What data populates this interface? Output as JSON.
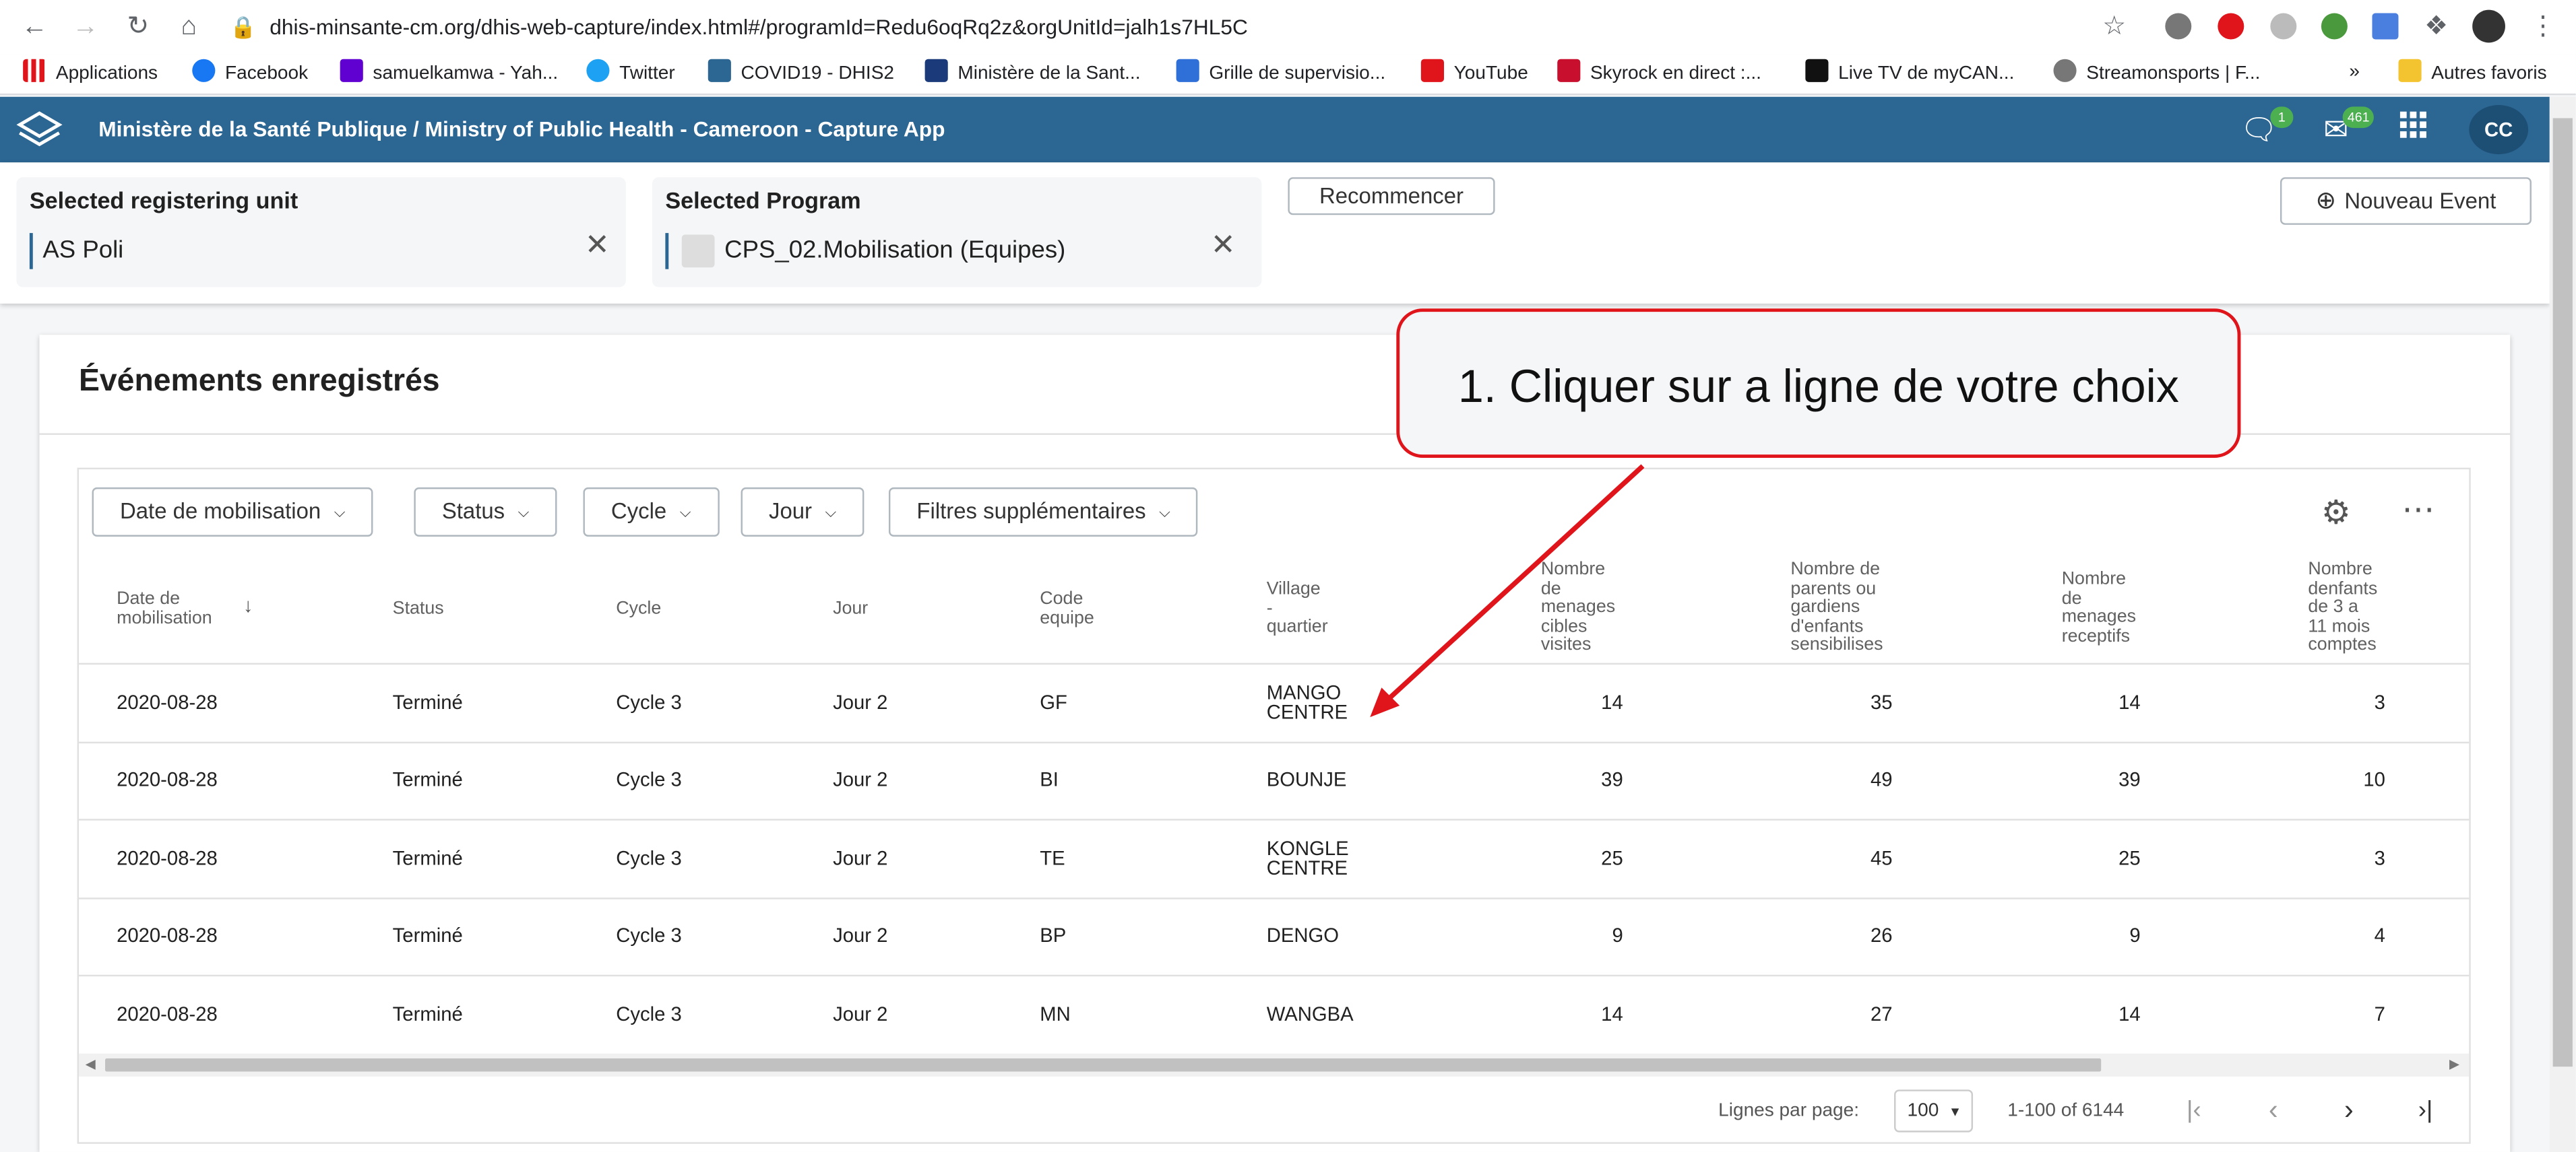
{
  "browser": {
    "url": "dhis-minsante-cm.org/dhis-web-capture/index.html#/programId=Redu6oqRq2z&orgUnitId=jalh1s7HL5C",
    "bookmarks": [
      "Applications",
      "Facebook",
      "samuelkamwa - Yah...",
      "Twitter",
      "COVID19 - DHIS2",
      "Ministère de la Sant...",
      "Grille de supervisio...",
      "YouTube",
      "Skyrock en direct :...",
      "Live TV de myCAN...",
      "Streamonsports | F..."
    ],
    "bookmarks_more": "»",
    "other_bookmarks": "Autres favoris"
  },
  "header": {
    "title": "Ministère de la Santé Publique / Ministry of Public Health - Cameroon - Capture App",
    "messages_badge": "1",
    "mail_badge": "461",
    "avatar": "CC"
  },
  "selectors": {
    "unit_label": "Selected registering unit",
    "unit_value": "AS Poli",
    "program_label": "Selected Program",
    "program_value": "CPS_02.Mobilisation (Equipes)",
    "reset_label": "Recommencer",
    "new_event_label": "Nouveau Event"
  },
  "main": {
    "title": "Événements enregistrés",
    "filters": [
      "Date de mobilisation",
      "Status",
      "Cycle",
      "Jour",
      "Filtres supplémentaires"
    ],
    "columns": [
      "Date de\nmobilisation",
      "Status",
      "Cycle",
      "Jour",
      "Code\nequipe",
      "Village\n-\nquartier",
      "Nombre\nde\nmenages\ncibles\nvisites",
      "Nombre de\nparents ou\ngardiens\nd'enfants\nsensibilises",
      "Nombre\nde\nmenages\nreceptifs",
      "Nombre\ndenfants\nde 3 a\n11 mois\ncomptes"
    ],
    "rows": [
      [
        "2020-08-28",
        "Terminé",
        "Cycle 3",
        "Jour 2",
        "GF",
        "MANGO\nCENTRE",
        "14",
        "35",
        "14",
        "3"
      ],
      [
        "2020-08-28",
        "Terminé",
        "Cycle 3",
        "Jour 2",
        "BI",
        "BOUNJE",
        "39",
        "49",
        "39",
        "10"
      ],
      [
        "2020-08-28",
        "Terminé",
        "Cycle 3",
        "Jour 2",
        "TE",
        "KONGLE\nCENTRE",
        "25",
        "45",
        "25",
        "3"
      ],
      [
        "2020-08-28",
        "Terminé",
        "Cycle 3",
        "Jour 2",
        "BP",
        "DENGO",
        "9",
        "26",
        "9",
        "4"
      ],
      [
        "2020-08-28",
        "Terminé",
        "Cycle 3",
        "Jour 2",
        "MN",
        "WANGBA",
        "14",
        "27",
        "14",
        "7"
      ]
    ],
    "pagination": {
      "rows_per_page_label": "Lignes par page:",
      "rows_per_page": "100",
      "range": "1-100 of 6144"
    }
  },
  "annotation": {
    "text": "1. Cliquer sur a ligne de votre choix"
  },
  "colors": {
    "header_bg": "#2c6693",
    "annotation_border": "#e0151b"
  }
}
